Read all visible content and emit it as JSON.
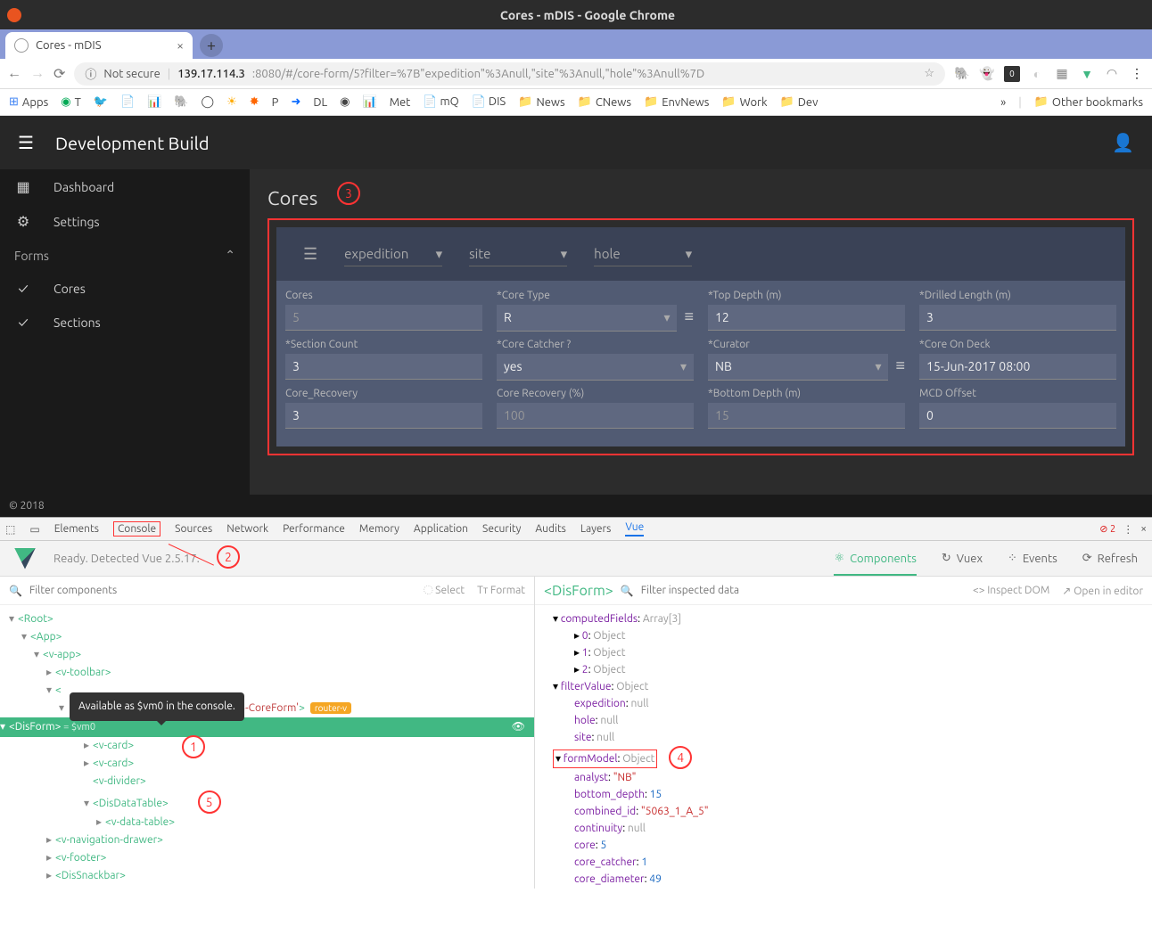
{
  "window": {
    "title": "Cores - mDIS - Google Chrome"
  },
  "tab": {
    "title": "Cores - mDIS"
  },
  "url": {
    "security": "Not secure",
    "host": "139.17.114.3",
    "path": ":8080/#/core-form/5?filter=%7B\"expedition\"%3Anull,\"site\"%3Anull,\"hole\"%3Anull%7D"
  },
  "bookmarks": {
    "apps": "Apps",
    "items": [
      "T",
      "",
      "",
      "",
      "",
      "",
      "",
      "P",
      "",
      "DL",
      "",
      "",
      "Met",
      "",
      "mQ",
      "",
      "DIS",
      "News",
      "CNews",
      "EnvNews",
      "Work",
      "Dev"
    ],
    "more": "»",
    "other": "Other bookmarks"
  },
  "app": {
    "title": "Development Build",
    "sidebar": {
      "dashboard": "Dashboard",
      "settings": "Settings",
      "forms": "Forms",
      "cores": "Cores",
      "sections": "Sections"
    },
    "main_title": "Cores",
    "filters": {
      "expedition": "expedition",
      "site": "site",
      "hole": "hole"
    },
    "form": {
      "cores": {
        "label": "Cores",
        "value": "5"
      },
      "core_type": {
        "label": "*Core Type",
        "value": "R"
      },
      "top_depth": {
        "label": "*Top Depth (m)",
        "value": "12"
      },
      "drilled_length": {
        "label": "*Drilled Length (m)",
        "value": "3"
      },
      "section_count": {
        "label": "*Section Count",
        "value": "3"
      },
      "core_catcher": {
        "label": "*Core Catcher ?",
        "value": "yes"
      },
      "curator": {
        "label": "*Curator",
        "value": "NB"
      },
      "core_on_deck": {
        "label": "*Core On Deck",
        "value": "15-Jun-2017 08:00"
      },
      "core_recovery": {
        "label": "Core_Recovery",
        "value": "3"
      },
      "core_recovery_pct": {
        "label": "Core Recovery (%)",
        "value": "100"
      },
      "bottom_depth": {
        "label": "*Bottom Depth (m)",
        "value": "15"
      },
      "mcd_offset": {
        "label": "MCD Offset",
        "value": "0"
      }
    },
    "footer": "© 2018"
  },
  "devtools": {
    "tabs": [
      "Elements",
      "Console",
      "Sources",
      "Network",
      "Performance",
      "Memory",
      "Application",
      "Security",
      "Audits",
      "Layers",
      "Vue"
    ],
    "errors": "2",
    "vue": {
      "ready": "Ready. Detected Vue 2.5.17.",
      "tabs": {
        "components": "Components",
        "vuex": "Vuex",
        "events": "Events",
        "refresh": "Refresh"
      },
      "filter_components": "Filter components",
      "select": "Select",
      "format": "Format",
      "filter_data": "Filter inspected data",
      "inspect_dom": "Inspect DOM",
      "open_editor": "Open in editor",
      "selected_component": "<DisForm>",
      "tooltip": "Available as $vm0 in the console.",
      "tree": {
        "root": "Root",
        "app": "App",
        "vapp": "v-app",
        "vtoolbar": "v-toolbar",
        "router_key": "'vue-component-405-CoreForm'",
        "router_badge": "router-v",
        "disform": "DisForm",
        "vm0": "= $vm0",
        "vcard": "v-card",
        "vdivider": "v-divider",
        "disdatatable": "DisDataTable",
        "vdatatable": "v-data-table",
        "vnav": "v-navigation-drawer",
        "vfooter": "v-footer",
        "dissnackbar": "DisSnackbar"
      },
      "data": {
        "computedFields": "computedFields",
        "computedFields_t": "Array[3]",
        "obj": "Object",
        "filterValue": "filterValue",
        "expedition": "expedition",
        "hole": "hole",
        "site": "site",
        "null": "null",
        "formModel": "formModel",
        "analyst": "analyst",
        "analyst_v": "\"NB\"",
        "bottom_depth": "bottom_depth",
        "bottom_depth_v": "15",
        "combined_id": "combined_id",
        "combined_id_v": "\"5063_1_A_5\"",
        "continuity": "continuity",
        "core": "core",
        "core_v": "5",
        "core_catcher": "core_catcher",
        "core_catcher_v": "1",
        "core_diameter": "core_diameter",
        "core_diameter_v": "49"
      }
    }
  },
  "annotations": {
    "1": "1",
    "2": "2",
    "3": "3",
    "4": "4",
    "5": "5"
  }
}
